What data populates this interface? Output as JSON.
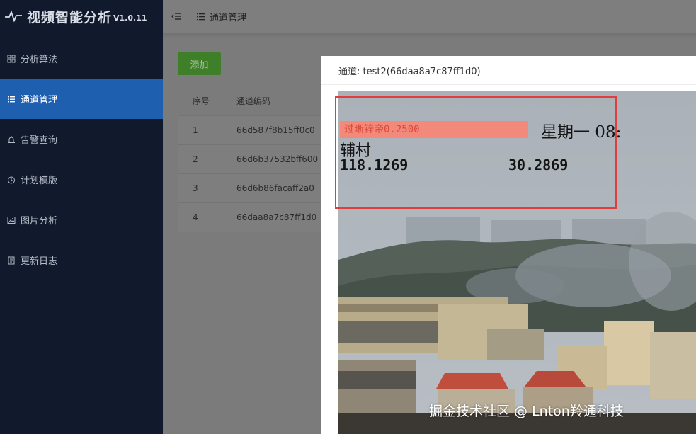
{
  "app": {
    "title": "视频智能分析",
    "version": "V1.0.11"
  },
  "sidebar": {
    "items": [
      {
        "label": "分析算法",
        "icon": "grid-icon",
        "active": false
      },
      {
        "label": "通道管理",
        "icon": "list-icon",
        "active": true
      },
      {
        "label": "告警查询",
        "icon": "alarm-icon",
        "active": false
      },
      {
        "label": "计划模版",
        "icon": "clock-icon",
        "active": false
      },
      {
        "label": "图片分析",
        "icon": "image-icon",
        "active": false
      },
      {
        "label": "更新日志",
        "icon": "document-icon",
        "active": false
      }
    ]
  },
  "topbar": {
    "breadcrumb": "通道管理"
  },
  "toolbar": {
    "add_label": "添加"
  },
  "table": {
    "headers": [
      "序号",
      "通道编码"
    ],
    "rows": [
      [
        "1",
        "66d587f8b15ff0c0"
      ],
      [
        "2",
        "66d6b37532bff600"
      ],
      [
        "3",
        "66d6b86facaff2a0"
      ],
      [
        "4",
        "66daa8a7c87ff1d0"
      ]
    ]
  },
  "modal": {
    "title": "通道: test2(66daa8a7c87ff1d0)",
    "osd": {
      "alert": "过晰锌帝0.2500",
      "weekday_time": "星期一 08:",
      "location": "辅村",
      "longitude": "118.1269",
      "latitude": "30.2869"
    }
  },
  "watermark": "掘金技术社区 @ Lnton羚通科技",
  "colors": {
    "sidebar_bg": "#111a2c",
    "active_item": "#1f5fb0",
    "add_button": "#3f7f2a",
    "highlight_border": "#e23d3d"
  }
}
